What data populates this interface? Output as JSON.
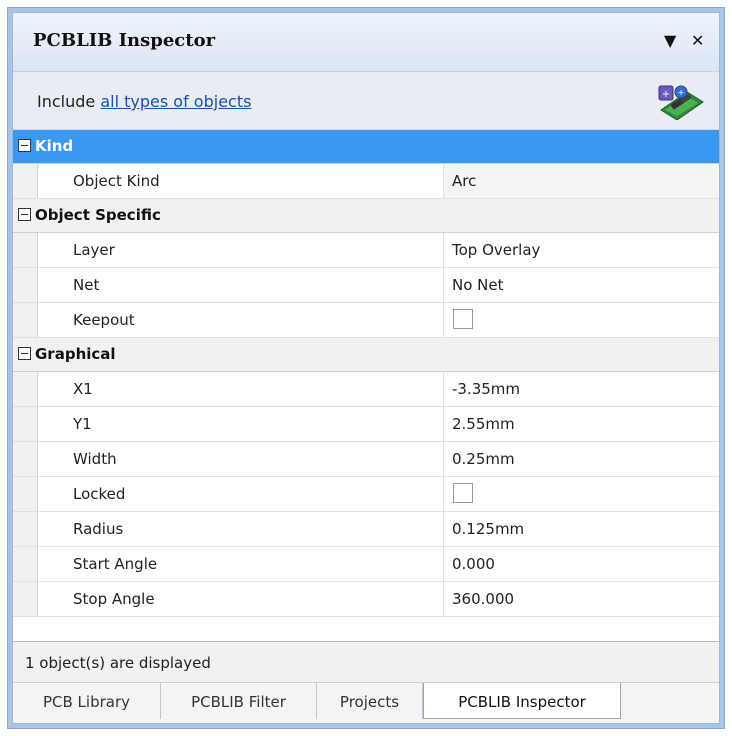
{
  "panel": {
    "title": "PCBLIB Inspector",
    "include_prefix": "Include",
    "include_link": "all types of objects"
  },
  "categories": [
    {
      "label": "Kind",
      "selected": true
    },
    {
      "label": "Object Specific"
    },
    {
      "label": "Graphical"
    }
  ],
  "kind": {
    "object_kind_label": "Object Kind",
    "object_kind_value": "Arc"
  },
  "object_specific": {
    "layer_label": "Layer",
    "layer_value": "Top Overlay",
    "net_label": "Net",
    "net_value": "No Net",
    "keepout_label": "Keepout",
    "keepout_checked": false
  },
  "graphical": {
    "x1_label": "X1",
    "x1_value": "-3.35mm",
    "y1_label": "Y1",
    "y1_value": "2.55mm",
    "width_label": "Width",
    "width_value": "0.25mm",
    "locked_label": "Locked",
    "locked_checked": false,
    "radius_label": "Radius",
    "radius_value": "0.125mm",
    "start_angle_label": "Start Angle",
    "start_angle_value": "0.000",
    "stop_angle_label": "Stop Angle",
    "stop_angle_value": "360.000"
  },
  "status": "1 object(s) are displayed",
  "tabs": [
    {
      "label": "PCB Library"
    },
    {
      "label": "PCBLIB Filter"
    },
    {
      "label": "Projects"
    },
    {
      "label": "PCBLIB Inspector",
      "active": true
    }
  ],
  "colors": {
    "selection": "#3b98f0",
    "link": "#1a4fb3"
  },
  "icons": {
    "menu": "triangle-down-icon",
    "close": "close-icon",
    "library": "pcb-library-icon"
  }
}
